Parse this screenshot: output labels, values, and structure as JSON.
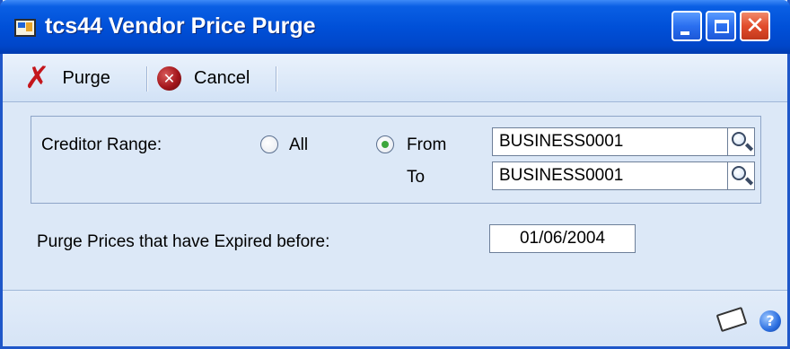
{
  "window": {
    "title": "tcs44 Vendor Price Purge",
    "icons": {
      "app": "window-app-icon",
      "minimize": "minimize-icon",
      "maximize": "maximize-icon",
      "close": "close-icon"
    },
    "close_glyph": "✕"
  },
  "toolbar": {
    "purge_label": "Purge",
    "purge_icon": "x-icon",
    "purge_glyph": "✗",
    "cancel_label": "Cancel",
    "cancel_icon": "cancel-circle-icon",
    "cancel_glyph": "✕"
  },
  "creditor_range": {
    "label": "Creditor Range:",
    "options": [
      "All",
      "From"
    ],
    "selected": "From",
    "to_label": "To",
    "from_value": "BUSINESS0001",
    "to_value": "BUSINESS0001",
    "lookup_icon": "magnifier-icon"
  },
  "purge": {
    "label": "Purge Prices that have Expired before:",
    "date_value": "01/06/2004"
  },
  "status": {
    "note_icon": "note-icon",
    "help_icon": "help-icon",
    "help_glyph": "?"
  },
  "colors": {
    "titlebar": "#0050d8",
    "body": "#dce8f7",
    "radio_selected": "#3ca63c",
    "purge_icon": "#c4161c"
  }
}
